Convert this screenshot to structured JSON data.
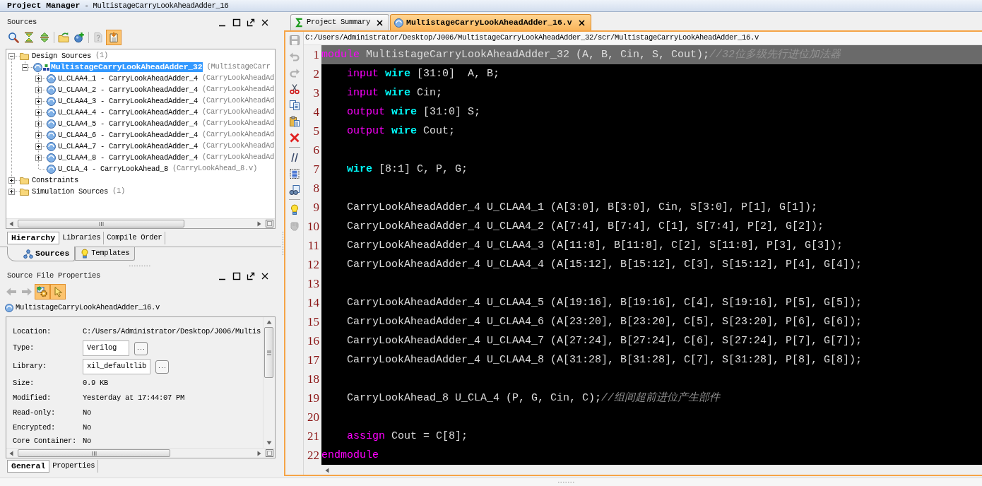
{
  "window": {
    "title": "**Project Manager** - MultistageCarryLookAheadAdder_16"
  },
  "sources": {
    "title": "Sources",
    "toolbar_groups": [
      {
        "buttons": [
          {
            "kind": "search",
            "on": false,
            "disabled": false
          },
          {
            "kind": "collapse",
            "on": false,
            "disabled": false
          },
          {
            "kind": "expand",
            "on": false,
            "disabled": false
          }
        ]
      },
      {
        "buttons": [
          {
            "kind": "add-folder",
            "on": false,
            "disabled": false
          },
          {
            "kind": "add-file",
            "on": false,
            "disabled": false
          }
        ]
      },
      {
        "buttons": [
          {
            "kind": "help",
            "on": false,
            "disabled": true
          },
          {
            "kind": "hierarchy",
            "on": true,
            "disabled": false
          }
        ]
      }
    ],
    "tree": [
      {
        "kind": "folder",
        "label": "Design Sources",
        "count": "(1)",
        "expanded": true,
        "selected": false,
        "children": [
          {
            "kind": "top",
            "label": "MultistageCarryLookAheadAdder_32",
            "file": "(MultistageCarr",
            "expanded": true,
            "selected": true,
            "children": [
              {
                "kind": "instance",
                "label": "U_CLAA4_1 - CarryLookAheadAdder_4",
                "file": "(CarryLookAheadAd",
                "expanded": false,
                "selected": false
              },
              {
                "kind": "instance",
                "label": "U_CLAA4_2 - CarryLookAheadAdder_4",
                "file": "(CarryLookAheadAd",
                "expanded": false,
                "selected": false
              },
              {
                "kind": "instance",
                "label": "U_CLAA4_3 - CarryLookAheadAdder_4",
                "file": "(CarryLookAheadAd",
                "expanded": false,
                "selected": false
              },
              {
                "kind": "instance",
                "label": "U_CLAA4_4 - CarryLookAheadAdder_4",
                "file": "(CarryLookAheadAd",
                "expanded": false,
                "selected": false
              },
              {
                "kind": "instance",
                "label": "U_CLAA4_5 - CarryLookAheadAdder_4",
                "file": "(CarryLookAheadAd",
                "expanded": false,
                "selected": false
              },
              {
                "kind": "instance",
                "label": "U_CLAA4_6 - CarryLookAheadAdder_4",
                "file": "(CarryLookAheadAd",
                "expanded": false,
                "selected": false
              },
              {
                "kind": "instance",
                "label": "U_CLAA4_7 - CarryLookAheadAdder_4",
                "file": "(CarryLookAheadAd",
                "expanded": false,
                "selected": false
              },
              {
                "kind": "instance",
                "label": "U_CLAA4_8 - CarryLookAheadAdder_4",
                "file": "(CarryLookAheadAd",
                "expanded": false,
                "selected": false
              },
              {
                "kind": "instance",
                "label": "U_CLA_4 - CarryLookAhead_8",
                "file": "(CarryLookAhead_8.v)",
                "selected": false
              }
            ]
          }
        ]
      },
      {
        "kind": "folder",
        "label": "Constraints",
        "expanded": false,
        "selected": false
      },
      {
        "kind": "folder",
        "label": "Simulation Sources",
        "count": "(1)",
        "expanded": false,
        "selected": false
      }
    ],
    "tabs": [
      {
        "label": "Hierarchy",
        "selected": true
      },
      {
        "label": "Libraries",
        "selected": false
      },
      {
        "label": "Compile Order",
        "selected": false
      }
    ]
  },
  "view_tabs": [
    {
      "kind": "sources",
      "label": "Sources",
      "selected": true
    },
    {
      "kind": "templates",
      "label": "Templates",
      "selected": false
    }
  ],
  "properties": {
    "title": "Source File Properties",
    "toolbar_groups": [
      {
        "buttons": [
          {
            "kind": "back",
            "on": false,
            "disabled": true
          },
          {
            "kind": "forward",
            "on": false,
            "disabled": true
          },
          {
            "kind": "config",
            "on": true,
            "disabled": false
          },
          {
            "kind": "select",
            "on": true,
            "disabled": false
          }
        ]
      }
    ],
    "file": "MultistageCarryLookAheadAdder_16.v",
    "rows": [
      {
        "kind": "text",
        "label": "Location:",
        "value": "C:/Users/Administrator/Desktop/J006/Multis"
      },
      {
        "kind": "field",
        "label": "Type:",
        "value": "Verilog",
        "button": "..."
      },
      {
        "kind": "field",
        "label": "Library:",
        "value": "xil_defaultlib",
        "button": "..."
      },
      {
        "kind": "text",
        "label": "Size:",
        "value": "0.9 KB"
      },
      {
        "kind": "text",
        "label": "Modified:",
        "value": "Yesterday at 17:44:07 PM"
      },
      {
        "kind": "text",
        "label": "Read-only:",
        "value": "No"
      },
      {
        "kind": "text",
        "label": "Encrypted:",
        "value": "No"
      },
      {
        "kind": "text",
        "label": "Core Container:",
        "value": "No"
      }
    ],
    "tabs": [
      {
        "label": "General",
        "selected": true
      },
      {
        "label": "Properties",
        "selected": false
      }
    ]
  },
  "editor": {
    "tabs": [
      {
        "kind": "summary",
        "label": "Project Summary",
        "selected": false
      },
      {
        "kind": "verilog",
        "label": "MultistageCarryLookAheadAdder_16.v",
        "selected": true
      }
    ],
    "toolbar_groups": [
      {
        "buttons": [
          {
            "kind": "save",
            "on": false,
            "disabled": true
          },
          {
            "kind": "undo",
            "on": false,
            "disabled": true
          },
          {
            "kind": "redo",
            "on": false,
            "disabled": true
          },
          {
            "kind": "cut",
            "on": false,
            "disabled": false
          },
          {
            "kind": "copy",
            "on": false,
            "disabled": false
          },
          {
            "kind": "paste",
            "on": false,
            "disabled": false
          },
          {
            "kind": "delete",
            "on": false,
            "disabled": false
          }
        ]
      },
      {
        "buttons": [
          {
            "kind": "comment",
            "on": false,
            "disabled": false
          },
          {
            "kind": "select-all",
            "on": false,
            "disabled": false
          },
          {
            "kind": "find",
            "on": false,
            "disabled": false
          }
        ]
      },
      {
        "buttons": [
          {
            "kind": "bulb",
            "on": false,
            "disabled": false
          },
          {
            "kind": "stamp",
            "on": false,
            "disabled": true
          }
        ]
      }
    ],
    "path": "C:/Users/Administrator/Desktop/J006/MultistageCarryLookAheadAdder_32/scr/MultistageCarryLookAheadAdder_16.v",
    "lines": [
      {
        "number": "1",
        "highlighted": true,
        "indented": false,
        "tokens": [
          {
            "kind": "keyword",
            "text": "module"
          },
          {
            "kind": "plain",
            "text": " MultistageCarryLookAheadAdder_32 (A, B, Cin, S, Cout);"
          },
          {
            "kind": "comment",
            "text": "//32位多级先行进位加法器"
          }
        ]
      },
      {
        "number": "2",
        "highlighted": false,
        "indented": true,
        "tokens": [
          {
            "kind": "keyword",
            "text": "input"
          },
          {
            "kind": "type",
            "text": " wire"
          },
          {
            "kind": "plain",
            "text": " [31:0]  A, B;"
          }
        ]
      },
      {
        "number": "3",
        "highlighted": false,
        "indented": true,
        "tokens": [
          {
            "kind": "keyword",
            "text": "input"
          },
          {
            "kind": "type",
            "text": " wire"
          },
          {
            "kind": "plain",
            "text": " Cin;"
          }
        ]
      },
      {
        "number": "4",
        "highlighted": false,
        "indented": true,
        "tokens": [
          {
            "kind": "keyword",
            "text": "output"
          },
          {
            "kind": "type",
            "text": " wire"
          },
          {
            "kind": "plain",
            "text": " [31:0] S;"
          }
        ]
      },
      {
        "number": "5",
        "highlighted": false,
        "indented": true,
        "tokens": [
          {
            "kind": "keyword",
            "text": "output"
          },
          {
            "kind": "type",
            "text": " wire"
          },
          {
            "kind": "plain",
            "text": " Cout;"
          }
        ]
      },
      {
        "number": "6",
        "highlighted": false
      },
      {
        "number": "7",
        "highlighted": false,
        "indented": true,
        "tokens": [
          {
            "kind": "type",
            "text": "wire"
          },
          {
            "kind": "plain",
            "text": " [8:1] C, P, G;"
          }
        ]
      },
      {
        "number": "8",
        "highlighted": false
      },
      {
        "number": "9",
        "highlighted": false,
        "indented": true,
        "tokens": [
          {
            "kind": "plain",
            "text": "CarryLookAheadAdder_4 U_CLAA4_1 (A[3:0], B[3:0], Cin, S[3:0], P[1], G[1]);"
          }
        ]
      },
      {
        "number": "10",
        "highlighted": false,
        "indented": true,
        "tokens": [
          {
            "kind": "plain",
            "text": "CarryLookAheadAdder_4 U_CLAA4_2 (A[7:4], B[7:4], C[1], S[7:4], P[2], G[2]);"
          }
        ]
      },
      {
        "number": "11",
        "highlighted": false,
        "indented": true,
        "tokens": [
          {
            "kind": "plain",
            "text": "CarryLookAheadAdder_4 U_CLAA4_3 (A[11:8], B[11:8], C[2], S[11:8], P[3], G[3]);"
          }
        ]
      },
      {
        "number": "12",
        "highlighted": false,
        "indented": true,
        "tokens": [
          {
            "kind": "plain",
            "text": "CarryLookAheadAdder_4 U_CLAA4_4 (A[15:12], B[15:12], C[3], S[15:12], P[4], G[4]);"
          }
        ]
      },
      {
        "number": "13",
        "highlighted": false
      },
      {
        "number": "14",
        "highlighted": false,
        "indented": true,
        "tokens": [
          {
            "kind": "plain",
            "text": "CarryLookAheadAdder_4 U_CLAA4_5 (A[19:16], B[19:16], C[4], S[19:16], P[5], G[5]);"
          }
        ]
      },
      {
        "number": "15",
        "highlighted": false,
        "indented": true,
        "tokens": [
          {
            "kind": "plain",
            "text": "CarryLookAheadAdder_4 U_CLAA4_6 (A[23:20], B[23:20], C[5], S[23:20], P[6], G[6]);"
          }
        ]
      },
      {
        "number": "16",
        "highlighted": false,
        "indented": true,
        "tokens": [
          {
            "kind": "plain",
            "text": "CarryLookAheadAdder_4 U_CLAA4_7 (A[27:24], B[27:24], C[6], S[27:24], P[7], G[7]);"
          }
        ]
      },
      {
        "number": "17",
        "highlighted": false,
        "indented": true,
        "tokens": [
          {
            "kind": "plain",
            "text": "CarryLookAheadAdder_4 U_CLAA4_8 (A[31:28], B[31:28], C[7], S[31:28], P[8], G[8]);"
          }
        ]
      },
      {
        "number": "18",
        "highlighted": false
      },
      {
        "number": "19",
        "highlighted": false,
        "indented": true,
        "tokens": [
          {
            "kind": "plain",
            "text": "CarryLookAhead_8 U_CLA_4 (P, G, Cin, C);"
          },
          {
            "kind": "comment",
            "text": "//组间超前进位产生部件"
          }
        ]
      },
      {
        "number": "20",
        "highlighted": false
      },
      {
        "number": "21",
        "highlighted": false,
        "indented": true,
        "tokens": [
          {
            "kind": "keyword",
            "text": "assign"
          },
          {
            "kind": "plain",
            "text": " Cout = C[8];"
          }
        ]
      },
      {
        "number": "22",
        "highlighted": false,
        "indented": false,
        "tokens": [
          {
            "kind": "keyword",
            "text": "endmodule"
          }
        ]
      }
    ]
  }
}
